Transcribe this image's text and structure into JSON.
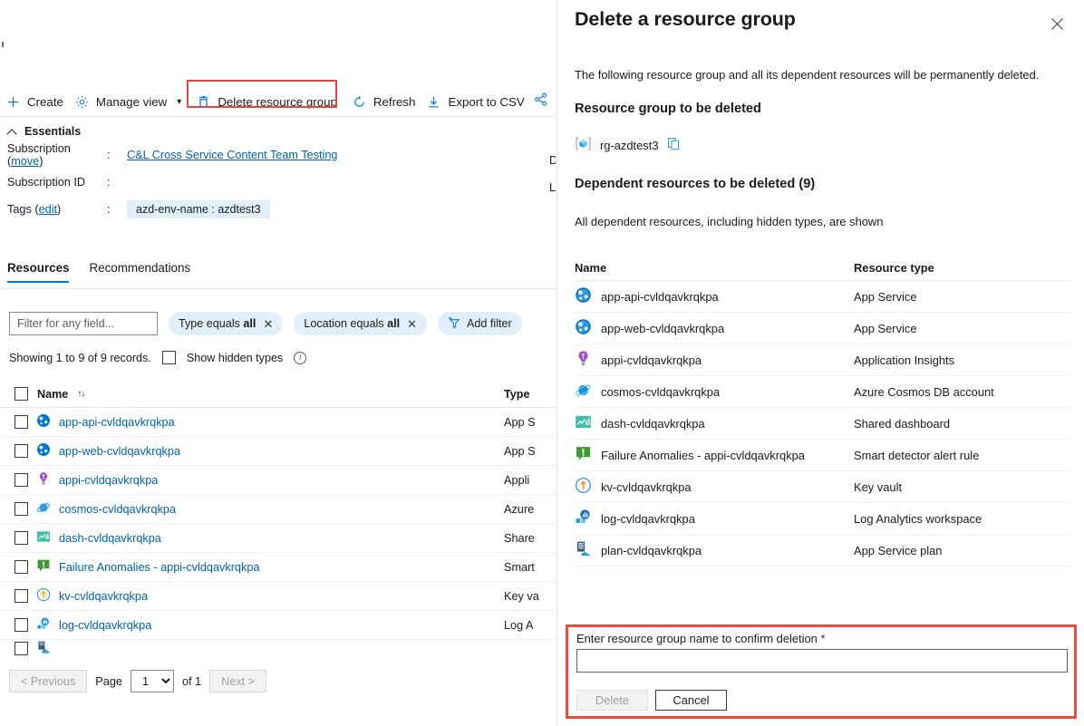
{
  "left_pane": {
    "toolbar": {
      "create_label": "Create",
      "manage_view_label": "Manage view",
      "delete_rg_label": "Delete resource group",
      "refresh_label": "Refresh",
      "export_csv_label": "Export to CSV",
      "highlight_color": "#e8453c"
    },
    "essentials": {
      "header": "Essentials",
      "rows": [
        {
          "label": "Subscription",
          "link_inline": "move",
          "colon": ":",
          "value": "C&L Cross Service Content Team Testing",
          "value_is_link": true
        },
        {
          "label": "Subscription ID",
          "link_inline": "",
          "colon": ":",
          "value": "",
          "value_is_link": false
        },
        {
          "label": "Tags",
          "link_inline": "edit",
          "colon": ":",
          "value": "azd-env-name : azdtest3",
          "value_is_link": false
        }
      ],
      "cut_off_right": [
        "D",
        "L"
      ]
    },
    "tabs": [
      {
        "label": "Resources",
        "active": true
      },
      {
        "label": "Recommendations",
        "active": false
      }
    ],
    "filters": {
      "search_placeholder": "Filter for any field...",
      "search_value": "",
      "pills": [
        {
          "prefix": "Type equals",
          "value": "all"
        },
        {
          "prefix": "Location equals",
          "value": "all"
        }
      ],
      "add_filter_label": "Add filter"
    },
    "showing_text": "Showing 1 to 9 of 9 records.",
    "show_hidden_types_label": "Show hidden types",
    "show_hidden_types_checked": false,
    "table": {
      "columns": [
        "Name",
        "Type"
      ],
      "rows": [
        {
          "name": "app-api-cvldqavkrqkpa",
          "type": "App S",
          "icon": "app-service-icon",
          "checked": false
        },
        {
          "name": "app-web-cvldqavkrqkpa",
          "type": "App S",
          "icon": "app-service-icon",
          "checked": false
        },
        {
          "name": "appi-cvldqavkrqkpa",
          "type": "Appli",
          "icon": "application-insights-icon",
          "checked": false
        },
        {
          "name": "cosmos-cvldqavkrqkpa",
          "type": "Azure",
          "icon": "cosmos-db-icon",
          "checked": false
        },
        {
          "name": "dash-cvldqavkrqkpa",
          "type": "Share",
          "icon": "dashboard-icon",
          "checked": false
        },
        {
          "name": "Failure Anomalies - appi-cvldqavkrqkpa",
          "type": "Smart",
          "icon": "alert-rule-icon",
          "checked": false
        },
        {
          "name": "kv-cvldqavkrqkpa",
          "type": "Key va",
          "icon": "key-vault-icon",
          "checked": false
        },
        {
          "name": "log-cvldqavkrqkpa",
          "type": "Log A",
          "icon": "log-analytics-icon",
          "checked": false
        }
      ]
    },
    "pagination": {
      "previous_label": "< Previous",
      "page_label": "Page",
      "page_value": "1",
      "of_label": "of 1",
      "next_label": "Next >"
    }
  },
  "right_panel": {
    "title": "Delete a resource group",
    "intro": "The following resource group and all its dependent resources will be permanently deleted.",
    "rg_section_heading": "Resource group to be deleted",
    "rg_name": "rg-azdtest3",
    "dep_section_heading": "Dependent resources to be deleted (9)",
    "dep_subtext": "All dependent resources, including hidden types, are shown",
    "dep_columns": [
      "Name",
      "Resource type"
    ],
    "dep_rows": [
      {
        "name": "app-api-cvldqavkrqkpa",
        "type": "App Service",
        "icon": "app-service-icon"
      },
      {
        "name": "app-web-cvldqavkrqkpa",
        "type": "App Service",
        "icon": "app-service-icon"
      },
      {
        "name": "appi-cvldqavkrqkpa",
        "type": "Application Insights",
        "icon": "application-insights-icon"
      },
      {
        "name": "cosmos-cvldqavkrqkpa",
        "type": "Azure Cosmos DB account",
        "icon": "cosmos-db-icon"
      },
      {
        "name": "dash-cvldqavkrqkpa",
        "type": "Shared dashboard",
        "icon": "dashboard-icon"
      },
      {
        "name": "Failure Anomalies - appi-cvldqavkrqkpa",
        "type": "Smart detector alert rule",
        "icon": "alert-rule-icon"
      },
      {
        "name": "kv-cvldqavkrqkpa",
        "type": "Key vault",
        "icon": "key-vault-icon"
      },
      {
        "name": "log-cvldqavkrqkpa",
        "type": "Log Analytics workspace",
        "icon": "log-analytics-icon"
      },
      {
        "name": "plan-cvldqavkrqkpa",
        "type": "App Service plan",
        "icon": "app-service-plan-icon"
      }
    ],
    "confirm": {
      "label": "Enter resource group name to confirm deletion",
      "required_marker": "*",
      "input_value": "",
      "delete_label": "Delete",
      "cancel_label": "Cancel",
      "highlight_color": "#ee4b3b"
    }
  },
  "theme": {
    "accent": "#0078d4",
    "link": "#0063b1",
    "pill_bg": "#e1effa",
    "highlight_red": "#e8453c",
    "text": "#1b1b1b"
  }
}
